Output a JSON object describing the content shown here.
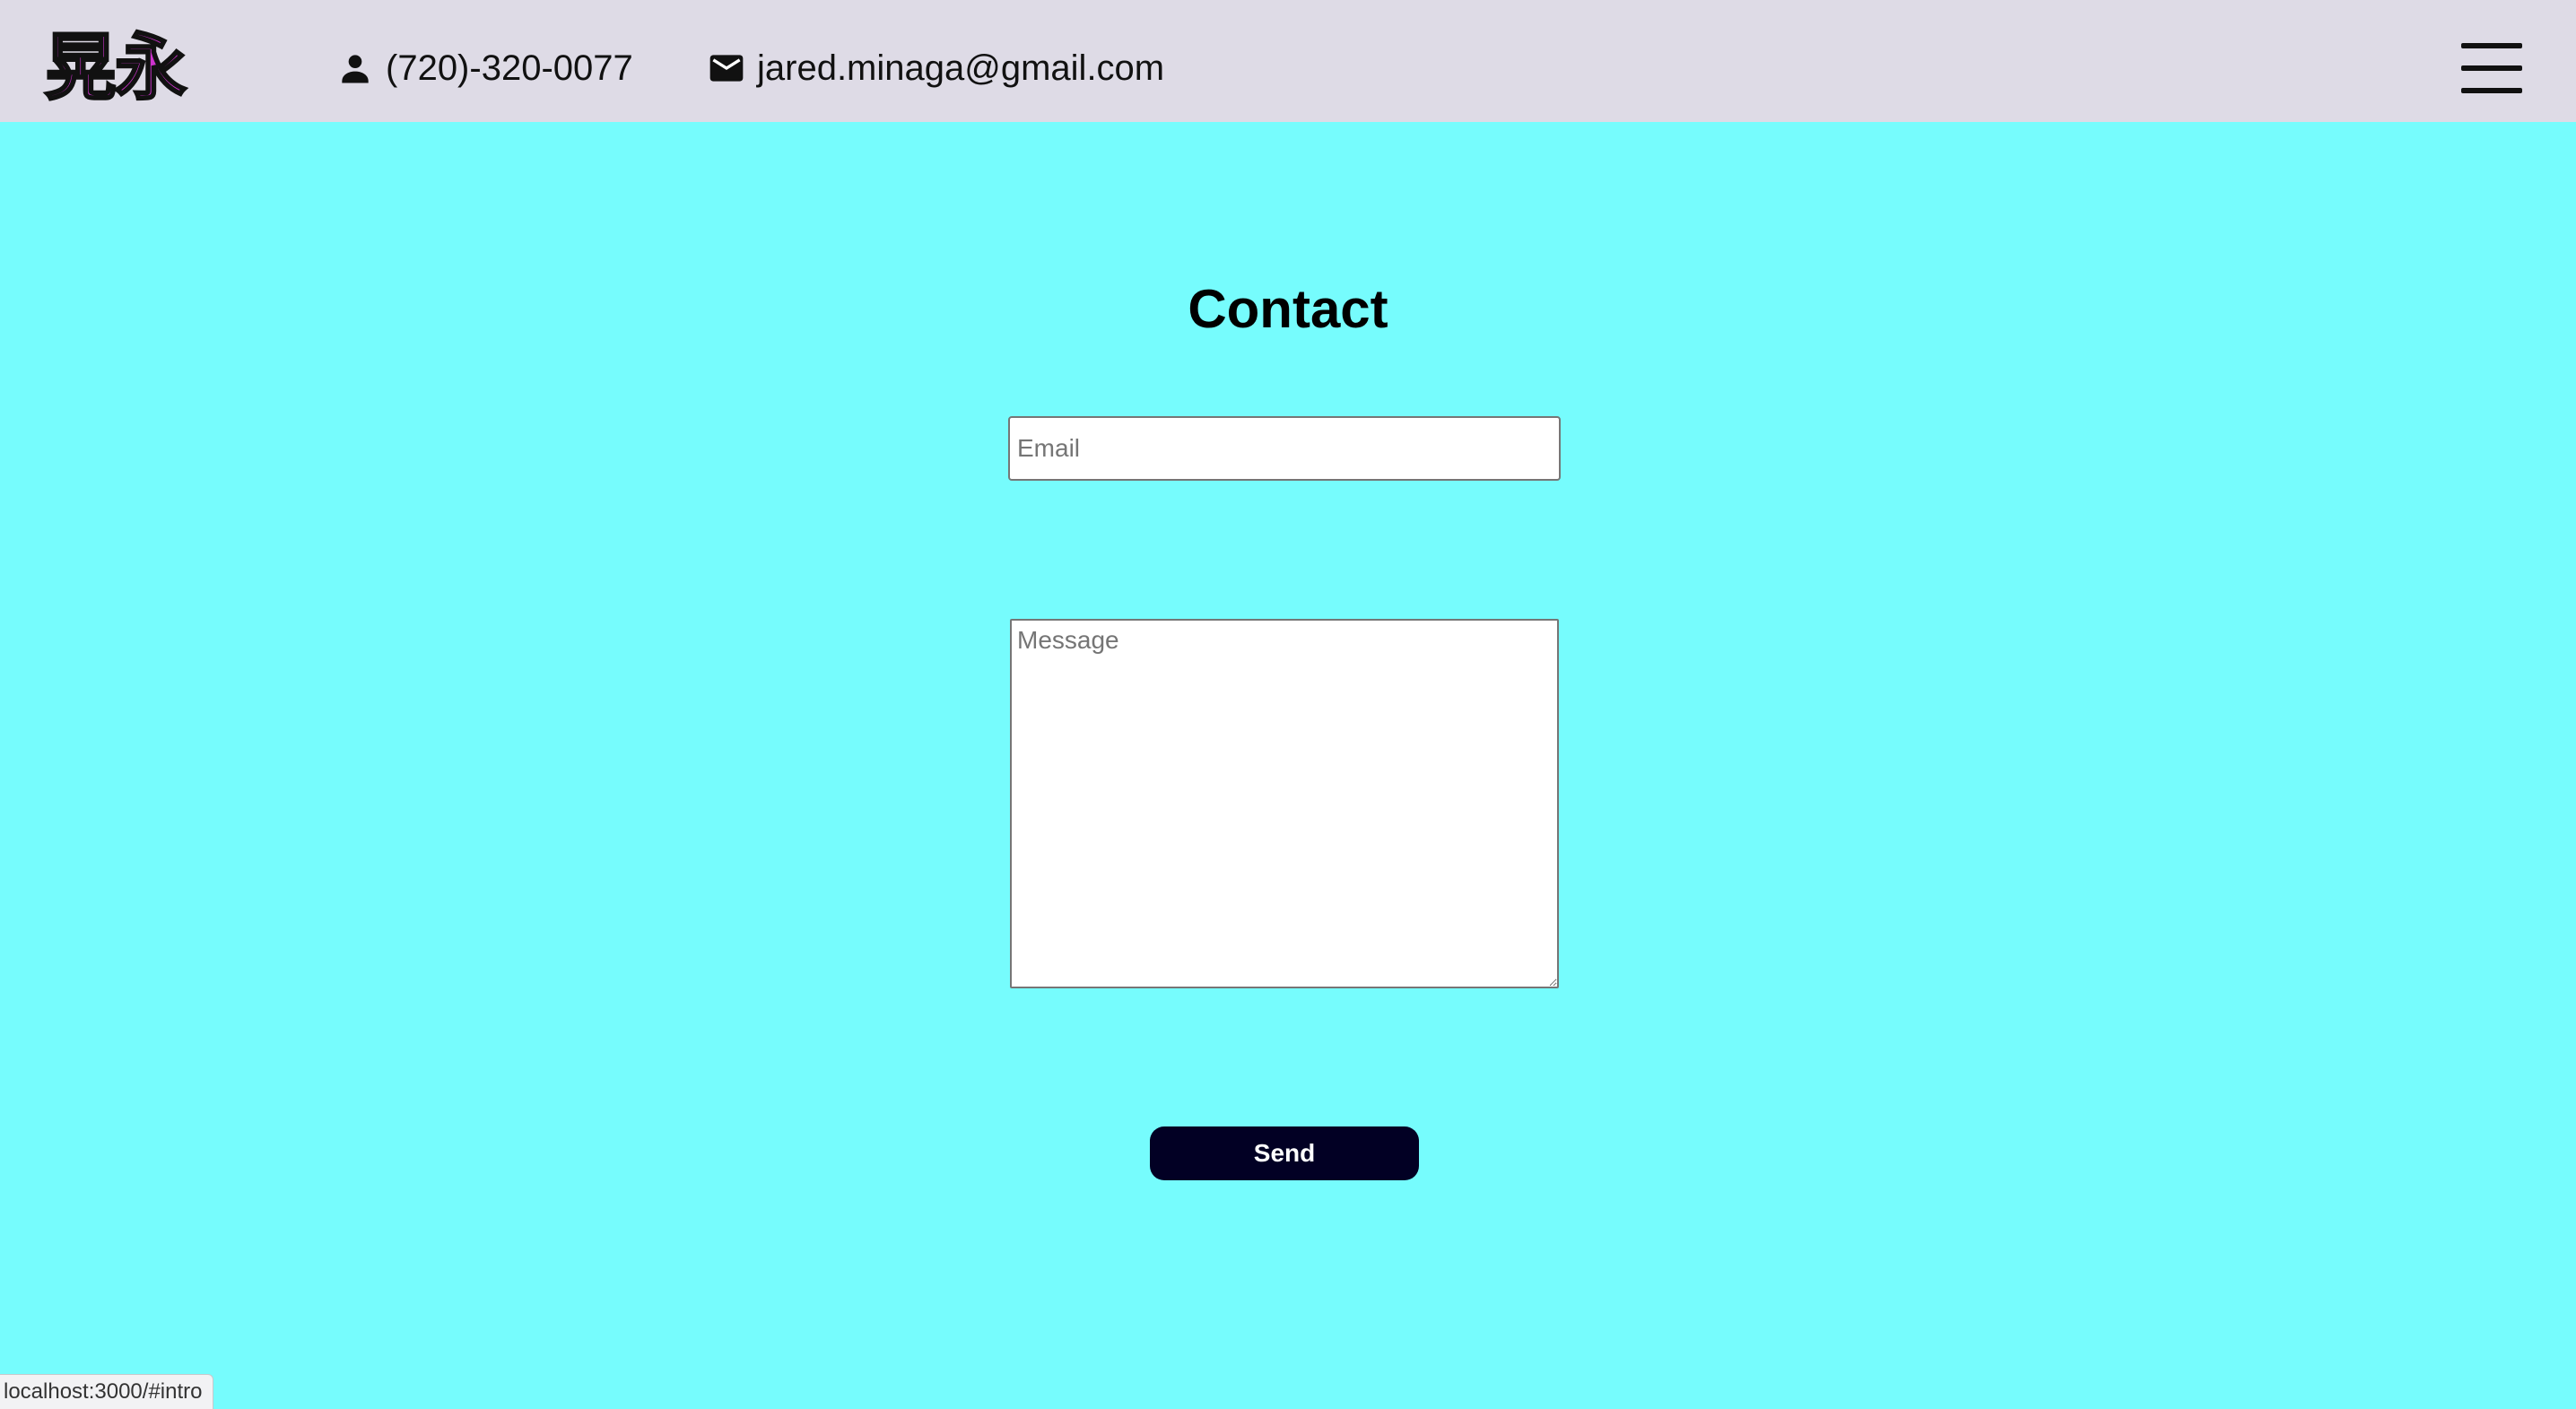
{
  "header": {
    "logo_text": "晃永",
    "logo_color": "#cc33cc",
    "background_color": "#dedbe6",
    "phone": {
      "icon": "person-icon",
      "text": "(720)-320-0077"
    },
    "email": {
      "icon": "mail-icon",
      "text": "jared.minaga@gmail.com"
    },
    "menu_icon": "hamburger-menu-icon"
  },
  "contact_form": {
    "title": "Contact",
    "email_placeholder": "Email",
    "email_value": "",
    "message_placeholder": "Message",
    "message_value": "",
    "send_label": "Send",
    "send_button_color": "#020024"
  },
  "page": {
    "background_color": "#76fcfd"
  },
  "status_bar": {
    "url": "localhost:3000/#intro"
  }
}
